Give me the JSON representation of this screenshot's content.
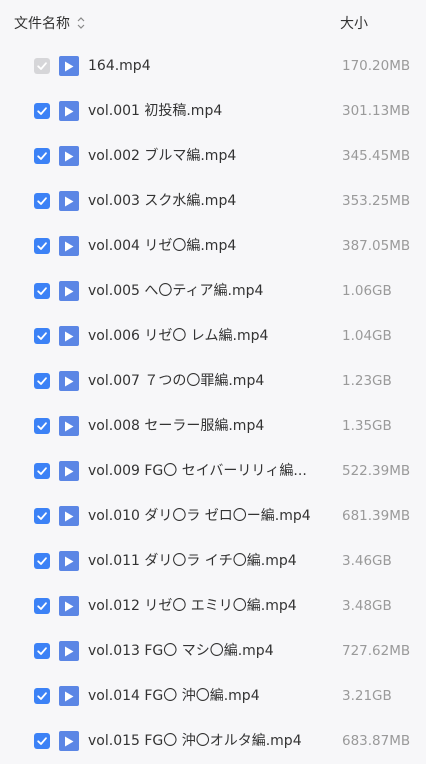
{
  "header": {
    "name_label": "文件名称",
    "size_label": "大小"
  },
  "files": [
    {
      "name": "164.mp4",
      "size": "170.20MB",
      "checked": true,
      "disabled": true
    },
    {
      "name": "vol.001 初投稿.mp4",
      "size": "301.13MB",
      "checked": true,
      "disabled": false
    },
    {
      "name": "vol.002 ブルマ編.mp4",
      "size": "345.45MB",
      "checked": true,
      "disabled": false
    },
    {
      "name": "vol.003 スク水編.mp4",
      "size": "353.25MB",
      "checked": true,
      "disabled": false
    },
    {
      "name": "vol.004 リゼ〇編.mp4",
      "size": "387.05MB",
      "checked": true,
      "disabled": false
    },
    {
      "name": "vol.005 へ〇ティア編.mp4",
      "size": "1.06GB",
      "checked": true,
      "disabled": false
    },
    {
      "name": "vol.006 リゼ〇 レム編.mp4",
      "size": "1.04GB",
      "checked": true,
      "disabled": false
    },
    {
      "name": "vol.007 ７つの〇罪編.mp4",
      "size": "1.23GB",
      "checked": true,
      "disabled": false
    },
    {
      "name": "vol.008 セーラー服編.mp4",
      "size": "1.35GB",
      "checked": true,
      "disabled": false
    },
    {
      "name": "vol.009 FG〇 セイバーリリィ編...",
      "size": "522.39MB",
      "checked": true,
      "disabled": false
    },
    {
      "name": "vol.010 ダリ〇ラ ゼロ〇ー編.mp4",
      "size": "681.39MB",
      "checked": true,
      "disabled": false
    },
    {
      "name": "vol.011 ダリ〇ラ イチ〇編.mp4",
      "size": "3.46GB",
      "checked": true,
      "disabled": false
    },
    {
      "name": "vol.012 リゼ〇 エミリ〇編.mp4",
      "size": "3.48GB",
      "checked": true,
      "disabled": false
    },
    {
      "name": "vol.013 FG〇 マシ〇編.mp4",
      "size": "727.62MB",
      "checked": true,
      "disabled": false
    },
    {
      "name": "vol.014 FG〇 沖〇編.mp4",
      "size": "3.21GB",
      "checked": true,
      "disabled": false
    },
    {
      "name": "vol.015 FG〇 沖〇オルタ編.mp4",
      "size": "683.87MB",
      "checked": true,
      "disabled": false
    }
  ],
  "icons": {
    "sort": "sort-updown-icon",
    "checkbox": "checkmark-icon",
    "file": "video-play-icon"
  },
  "colors": {
    "accent": "#3c82f6",
    "file_icon": "#5b86e5",
    "disabled_checkbox": "#d6d6d9",
    "size_text": "#9a9a9a"
  }
}
